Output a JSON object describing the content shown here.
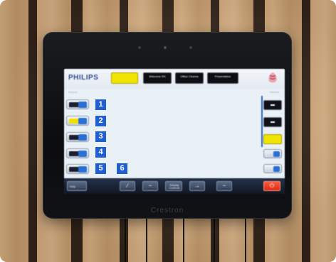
{
  "panel": {
    "brand": "PHILIPS",
    "device_brand": "Crestron",
    "top_buttons": [
      {
        "label": "",
        "active": true
      },
      {
        "label": "Welcome RX",
        "active": false
      },
      {
        "label": "Office Cinema",
        "active": false
      },
      {
        "label": "Presentation",
        "active": false
      }
    ],
    "left_caption": "Source",
    "right_caption": "Volume",
    "source_buttons": [
      {
        "number": "1",
        "style": "dark"
      },
      {
        "number": "2",
        "style": "yellow"
      },
      {
        "number": "3",
        "style": "dark"
      },
      {
        "number": "4",
        "style": "dark"
      },
      {
        "number": "5",
        "style": "dark"
      }
    ],
    "extra_badge": "6",
    "bottom_bar": {
      "left_label": "Help",
      "center_label": "Display Controls"
    }
  },
  "colors": {
    "badge_blue": "#1f5fd1",
    "highlight_yellow": "#f1e400",
    "power_red": "#e8341a",
    "brand_blue": "#2f4b8c"
  },
  "icons": {
    "power": "power-icon",
    "brand_mark": "philips-shield-icon",
    "volume_up": "volume-up-icon",
    "volume_down": "volume-down-icon"
  }
}
